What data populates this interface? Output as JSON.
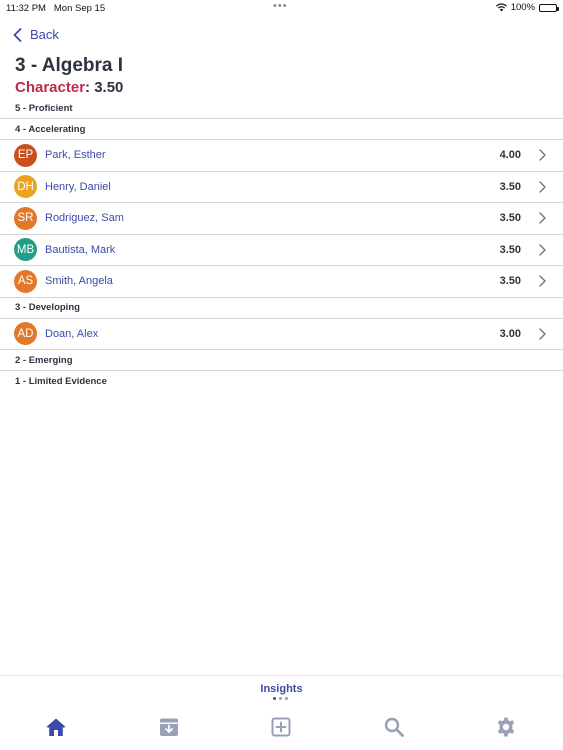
{
  "status_bar": {
    "time": "11:32 PM",
    "date": "Mon Sep 15",
    "battery": "100%"
  },
  "nav": {
    "back_label": "Back"
  },
  "header": {
    "title": "3 - Algebra I",
    "subtitle_label": "Character",
    "subtitle_value": ": 3.50"
  },
  "sections": {
    "proficient": "5 - Proficient",
    "accelerating": "4 - Accelerating",
    "developing": "3 - Developing",
    "emerging": "2 - Emerging",
    "limited": "1 - Limited Evidence"
  },
  "students": [
    {
      "initials": "EP",
      "name": "Park, Esther",
      "score": "4.00",
      "color": "#c9501c"
    },
    {
      "initials": "DH",
      "name": "Henry, Daniel",
      "score": "3.50",
      "color": "#e9a31f"
    },
    {
      "initials": "SR",
      "name": "Rodriguez, Sam",
      "score": "3.50",
      "color": "#e4782a"
    },
    {
      "initials": "MB",
      "name": "Bautista, Mark",
      "score": "3.50",
      "color": "#1f9f86"
    },
    {
      "initials": "AS",
      "name": "Smith, Angela",
      "score": "3.50",
      "color": "#e4782a"
    },
    {
      "initials": "AD",
      "name": "Doan, Alex",
      "score": "3.00",
      "color": "#e4782a"
    }
  ],
  "bottom": {
    "insights_label": "Insights"
  },
  "tabs": [
    "home-icon",
    "archive-icon",
    "add-icon",
    "search-icon",
    "settings-icon"
  ],
  "colors": {
    "accent": "#3d4aa6",
    "character": "#c0294b",
    "divider": "#d5d5d8"
  }
}
